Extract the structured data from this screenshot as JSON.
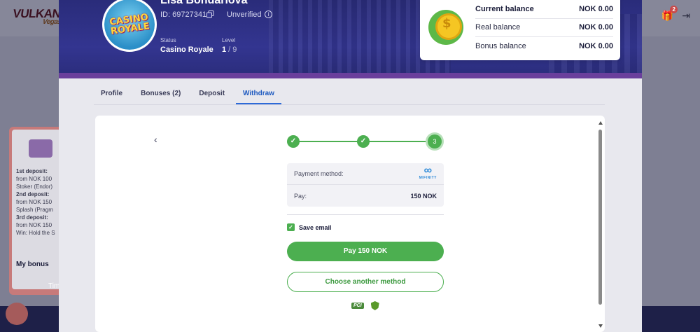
{
  "background": {
    "logo_text": "VULKAN",
    "logo_sub": "Vegas",
    "gift_badge": "2",
    "promo": {
      "first_deposit": "1st deposit:",
      "first_detail": "from NOK 100",
      "first_detail2": "Stoker (Endor)",
      "second_deposit": "2nd deposit:",
      "second_detail": "from NOK 150",
      "second_detail2": "Splash (Pragm",
      "third_deposit": "3rd deposit:",
      "third_detail": "from NOK 150",
      "third_detail2": "Win: Hold the S",
      "my_bonus": "My bonus",
      "timer": "Tim"
    }
  },
  "profile": {
    "name": "Lisa Bondarlova",
    "id_label": "ID: 69727341",
    "verification": "Unverified",
    "status_label": "Status",
    "status_value": "Casino Royale",
    "level_label": "Level",
    "level_current": "1",
    "level_total": " / 9",
    "avatar_text_1": "CASINO",
    "avatar_text_2": "ROYALE"
  },
  "balance": {
    "rows": [
      {
        "label": "Current balance",
        "value": "NOK 0.00"
      },
      {
        "label": "Real balance",
        "value": "NOK 0.00"
      },
      {
        "label": "Bonus balance",
        "value": "NOK 0.00"
      }
    ]
  },
  "tabs": [
    {
      "label": "Profile",
      "active": false
    },
    {
      "label": "Bonuses (2)",
      "active": false
    },
    {
      "label": "Deposit",
      "active": false
    },
    {
      "label": "Withdraw",
      "active": true
    }
  ],
  "withdraw": {
    "steps": [
      {
        "label": "✓",
        "state": "done"
      },
      {
        "label": "✓",
        "state": "done"
      },
      {
        "label": "3",
        "state": "current"
      }
    ],
    "payment_method_label": "Payment method:",
    "payment_method_name": "MIFINITY",
    "pay_label": "Pay:",
    "pay_value": "150 NOK",
    "save_email_label": "Save email",
    "save_email_checked": true,
    "pay_button": "Pay 150 NOK",
    "alt_button": "Choose another method",
    "pci_label": "PCI"
  },
  "colors": {
    "accent_green": "#4caf50",
    "hero_blue": "#333590",
    "tab_active": "#1e5ac0"
  }
}
